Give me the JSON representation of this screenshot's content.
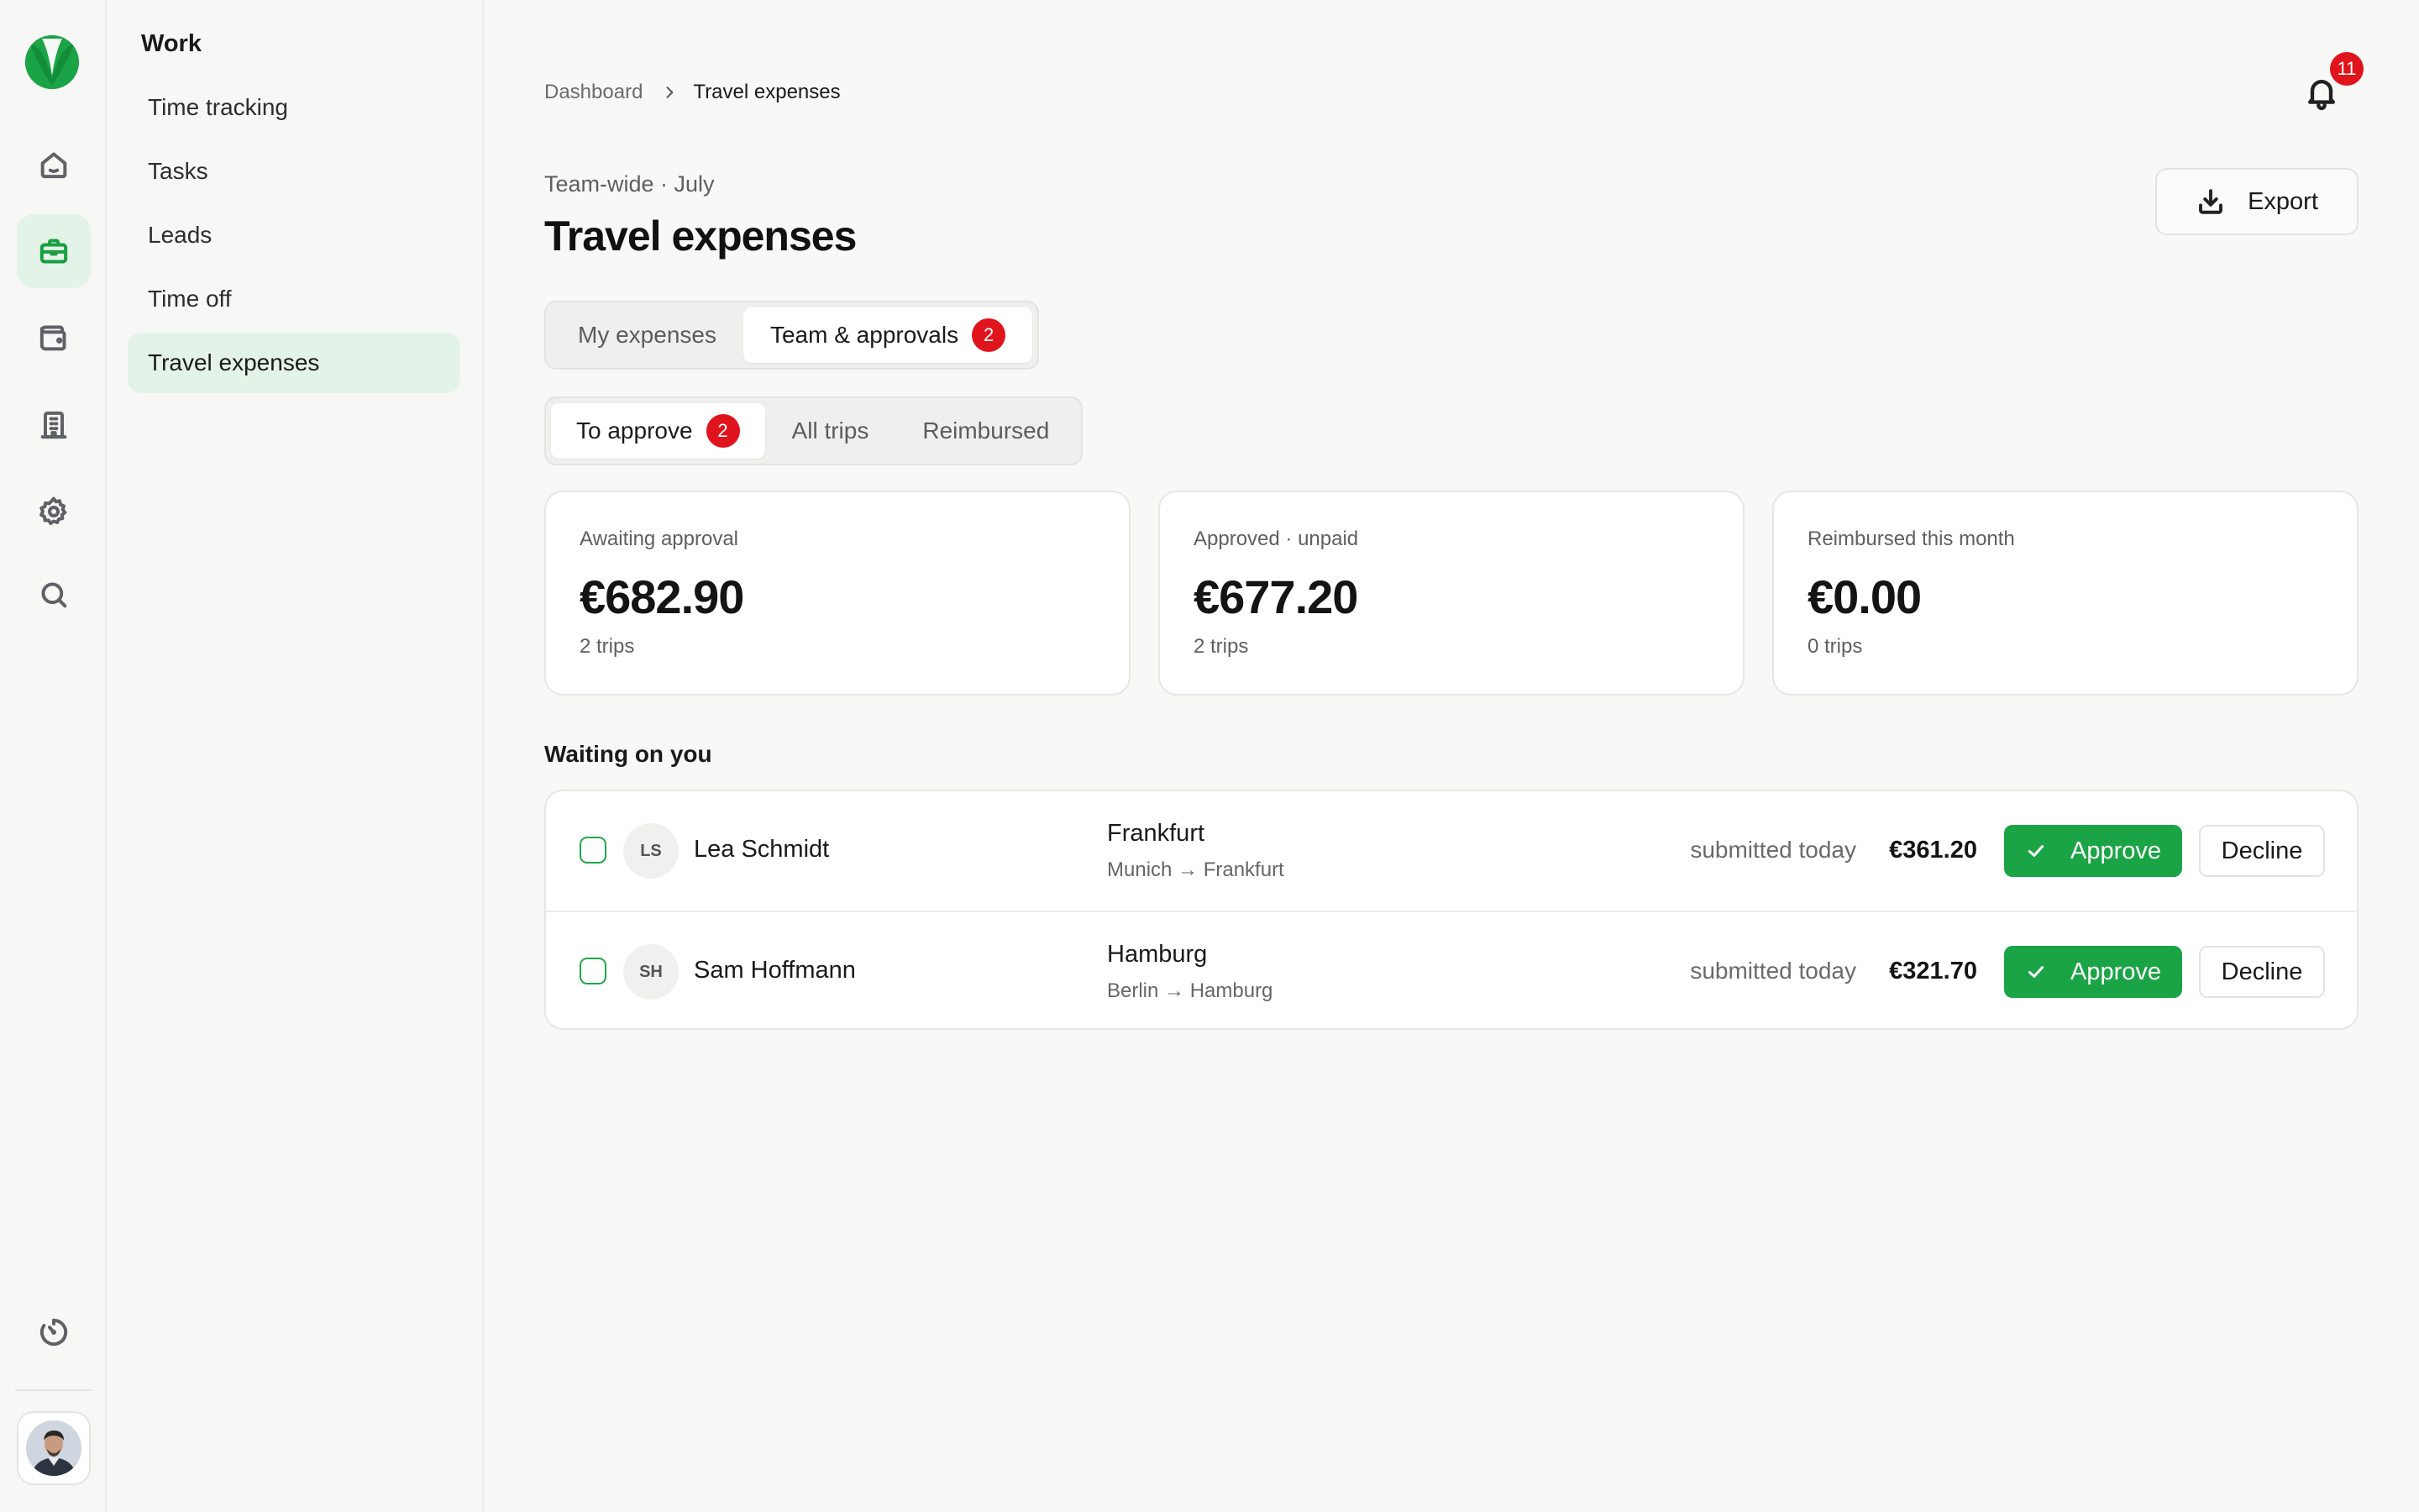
{
  "colors": {
    "accent": "#1ba446",
    "accent_soft": "#e4f3e7",
    "badge": "#e0141c"
  },
  "rail": {
    "icons": [
      "home-icon",
      "briefcase-icon",
      "wallet-icon",
      "building-icon",
      "gear-icon",
      "search-icon",
      "timer-icon"
    ],
    "active": "briefcase-icon"
  },
  "subnav": {
    "title": "Work",
    "items": [
      {
        "label": "Time tracking"
      },
      {
        "label": "Tasks"
      },
      {
        "label": "Leads"
      },
      {
        "label": "Time off"
      },
      {
        "label": "Travel expenses",
        "active": true
      }
    ]
  },
  "breadcrumb": {
    "parent": "Dashboard",
    "current": "Travel expenses"
  },
  "notifications": {
    "count": "11"
  },
  "header": {
    "eyebrow": "Team-wide · July",
    "title": "Travel expenses",
    "export_label": "Export"
  },
  "tabs": [
    {
      "label": "My expenses",
      "active": false
    },
    {
      "label": "Team & approvals",
      "active": true,
      "badge": "2"
    }
  ],
  "filters": [
    {
      "label": "To approve",
      "active": true,
      "badge": "2"
    },
    {
      "label": "All trips",
      "active": false
    },
    {
      "label": "Reimbursed",
      "active": false
    }
  ],
  "summary": [
    {
      "label": "Awaiting approval",
      "value": "€682.90",
      "sub": "2 trips"
    },
    {
      "label": "Approved · unpaid",
      "value": "€677.20",
      "sub": "2 trips"
    },
    {
      "label": "Reimbursed this month",
      "value": "€0.00",
      "sub": "0 trips"
    }
  ],
  "waiting": {
    "title": "Waiting on you",
    "approve_label": "Approve",
    "decline_label": "Decline",
    "rows": [
      {
        "initials": "LS",
        "name": "Lea Schmidt",
        "destination": "Frankfurt",
        "route": "Munich → Frankfurt",
        "submitted": "submitted today",
        "amount": "€361.20"
      },
      {
        "initials": "SH",
        "name": "Sam Hoffmann",
        "destination": "Hamburg",
        "route": "Berlin → Hamburg",
        "submitted": "submitted today",
        "amount": "€321.70"
      }
    ]
  }
}
